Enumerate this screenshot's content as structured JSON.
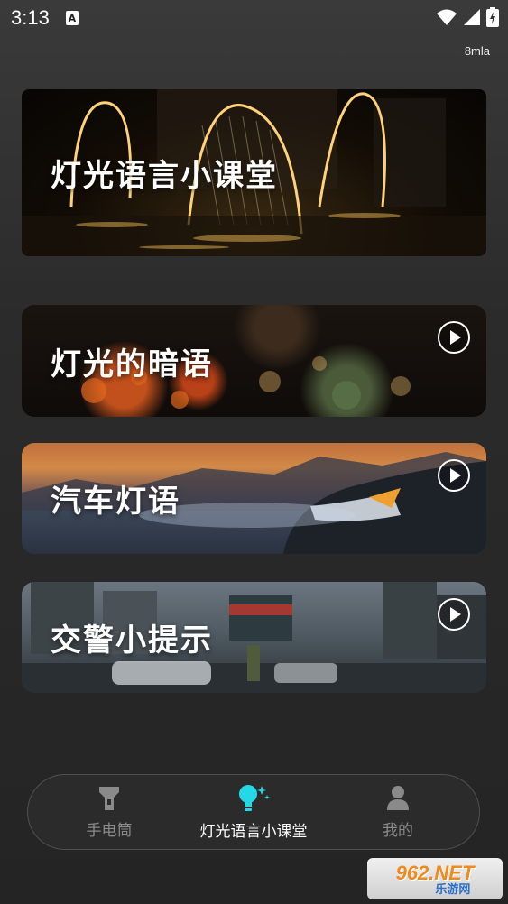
{
  "status_bar": {
    "time": "3:13",
    "notification_letter": "A"
  },
  "version_label": "8mla",
  "hero": {
    "title": "灯光语言小课堂"
  },
  "cards": [
    {
      "title": "灯光的暗语"
    },
    {
      "title": "汽车灯语"
    },
    {
      "title": "交警小提示"
    }
  ],
  "tabs": [
    {
      "label": "手电筒",
      "icon": "flashlight-icon"
    },
    {
      "label": "灯光语言小课堂",
      "icon": "lightbulb-icon",
      "active": true
    },
    {
      "label": "我的",
      "icon": "profile-icon"
    }
  ],
  "watermark": {
    "text": "962.NET",
    "sub": "乐游网"
  },
  "colors": {
    "accent": "#25d8e6",
    "inactive": "#8a8a8a",
    "background": "#2b2b2b"
  }
}
